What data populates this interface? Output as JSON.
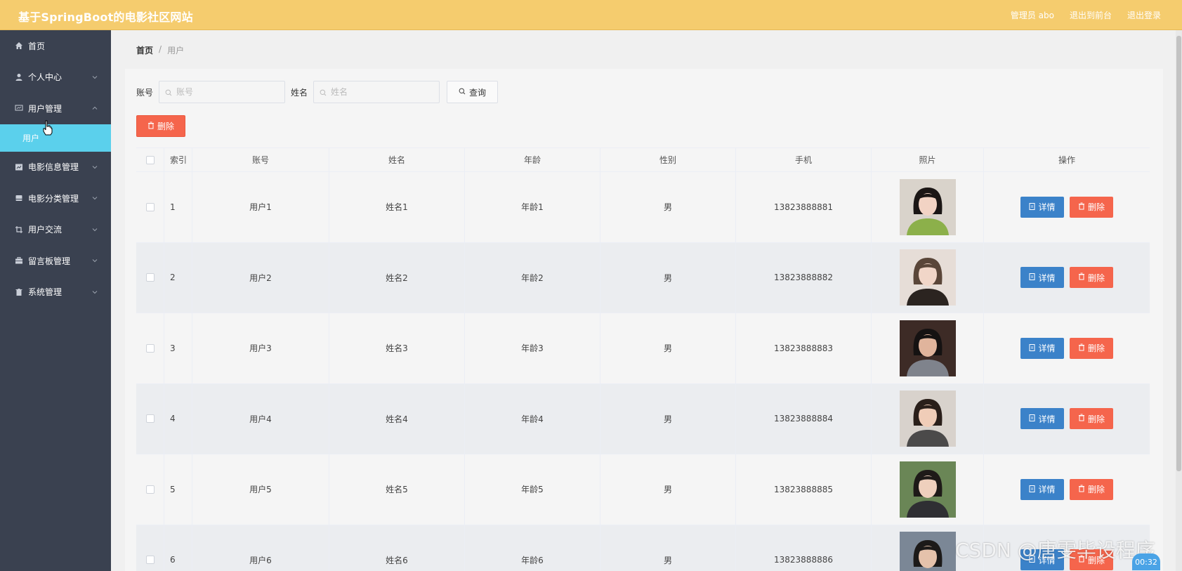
{
  "header": {
    "title": "基于SpringBoot的电影社区网站",
    "links": [
      "管理员 abo",
      "退出到前台",
      "退出登录"
    ]
  },
  "sidebar": {
    "items": [
      {
        "label": "首页",
        "icon": "home-icon",
        "chevron": false
      },
      {
        "label": "个人中心",
        "icon": "user-icon",
        "chevron": true
      },
      {
        "label": "用户管理",
        "icon": "monitor-icon",
        "chevron": true,
        "expanded": true
      },
      {
        "label": "电影信息管理",
        "icon": "chart-icon",
        "chevron": true
      },
      {
        "label": "电影分类管理",
        "icon": "folder-icon",
        "chevron": true
      },
      {
        "label": "用户交流",
        "icon": "crop-icon",
        "chevron": true
      },
      {
        "label": "留言板管理",
        "icon": "briefcase-icon",
        "chevron": true
      },
      {
        "label": "系统管理",
        "icon": "trash-icon",
        "chevron": true
      }
    ],
    "submenu_active": "用户"
  },
  "breadcrumb": {
    "home": "首页",
    "separator": "/",
    "current": "用户"
  },
  "search": {
    "account_label": "账号",
    "account_placeholder": "账号",
    "name_label": "姓名",
    "name_placeholder": "姓名",
    "query_label": "查询"
  },
  "toolbar": {
    "delete_label": "删除"
  },
  "table": {
    "headers": [
      "索引",
      "账号",
      "姓名",
      "年龄",
      "性别",
      "手机",
      "照片",
      "操作"
    ],
    "rows": [
      {
        "idx": "1",
        "account": "用户1",
        "name": "姓名1",
        "age": "年龄1",
        "sex": "男",
        "phone": "13823888881"
      },
      {
        "idx": "2",
        "account": "用户2",
        "name": "姓名2",
        "age": "年龄2",
        "sex": "男",
        "phone": "13823888882"
      },
      {
        "idx": "3",
        "account": "用户3",
        "name": "姓名3",
        "age": "年龄3",
        "sex": "男",
        "phone": "13823888883"
      },
      {
        "idx": "4",
        "account": "用户4",
        "name": "姓名4",
        "age": "年龄4",
        "sex": "男",
        "phone": "13823888884"
      },
      {
        "idx": "5",
        "account": "用户5",
        "name": "姓名5",
        "age": "年龄5",
        "sex": "男",
        "phone": "13823888885"
      },
      {
        "idx": "6",
        "account": "用户6",
        "name": "姓名6",
        "age": "年龄6",
        "sex": "男",
        "phone": "13823888886"
      }
    ],
    "detail_label": "详情",
    "delete_label": "删除"
  },
  "overlay": {
    "watermark": "CSDN @唐雯毕设程序",
    "timer": "00:32"
  },
  "colors": {
    "header_bg": "#f5cc6e",
    "sidebar_bg": "#3a4150",
    "active_submenu": "#5bd0ec",
    "danger": "#f5654c",
    "primary": "#3b82c9"
  }
}
